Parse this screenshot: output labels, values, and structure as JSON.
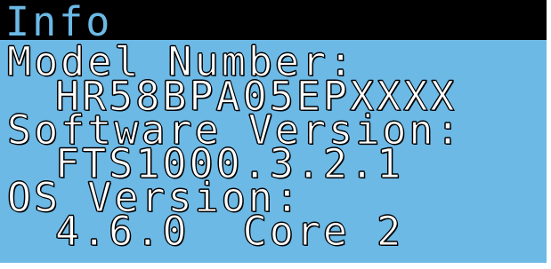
{
  "screen": {
    "title": "Info",
    "colors": {
      "background": "#6cb9e6",
      "title_bar": "#000000",
      "text": "#ffffff",
      "text_outline": "#000000"
    },
    "fields": [
      {
        "label": "Model Number:",
        "value": "HR58BPA05EPXXXX"
      },
      {
        "label": "Software Version:",
        "value": "FTS1000.3.2.1"
      },
      {
        "label": "OS Version:",
        "value": "4.6.0  Core 2"
      }
    ]
  }
}
